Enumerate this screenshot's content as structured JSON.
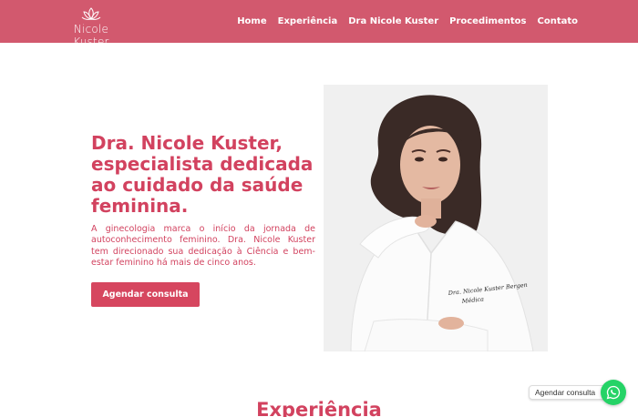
{
  "brand": {
    "name": "Nicole Kuster",
    "logo_icon": "lotus-icon"
  },
  "nav": {
    "items": [
      "Home",
      "Experiência",
      "Dra Nicole Kuster",
      "Procedimentos",
      "Contato"
    ]
  },
  "hero": {
    "title": "Dra. Nicole Kuster, especialista dedicada ao cuidado da saúde feminina.",
    "description": "A ginecologia marca o início da jornada de autoconhecimento feminino. Dra. Nicole Kuster tem direcionado sua dedicação à Ciência e bem-estar feminino há mais de cinco anos.",
    "cta_label": "Agendar consulta"
  },
  "photo": {
    "coat_embroidery_line1": "Dra. Nicole Kuster Bergen",
    "coat_embroidery_line2": "Médica"
  },
  "next_section": {
    "title": "Experiência"
  },
  "whatsapp": {
    "label": "Agendar consulta",
    "icon": "whatsapp-icon"
  },
  "colors": {
    "brand": "#d2596e",
    "accent": "#d2425f",
    "whatsapp": "#25d366"
  }
}
